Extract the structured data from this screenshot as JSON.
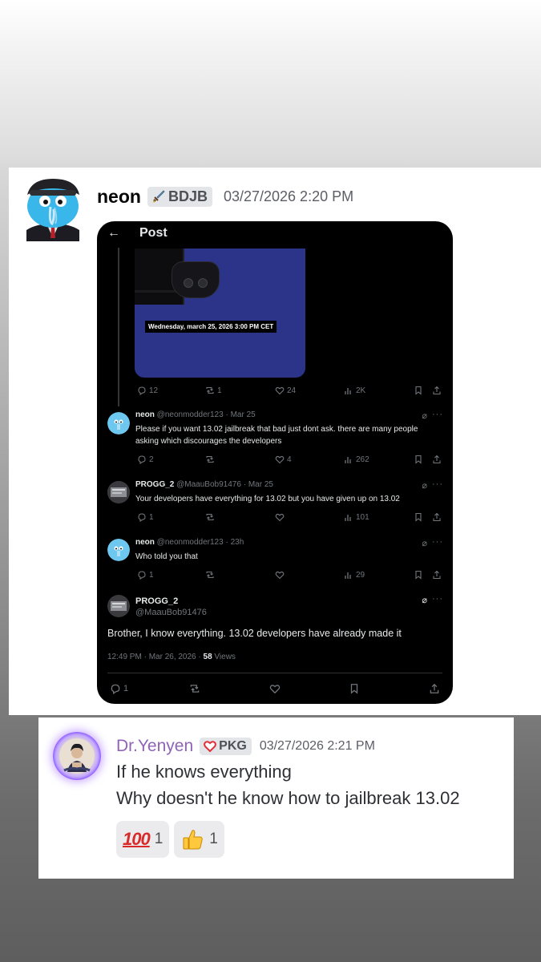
{
  "message1": {
    "username": "neon",
    "role_tag": "BDJB",
    "timestamp": "03/27/2026 2:20 PM",
    "screenshot": {
      "header_title": "Post",
      "media_date_banner": "Wednesday, march 25, 2026 3:00 PM CET",
      "parent_stats": {
        "replies": "12",
        "reposts": "1",
        "likes": "24",
        "views": "2K"
      },
      "replies": [
        {
          "name": "neon",
          "handle": "@neonmodder123",
          "time": "Mar 25",
          "text": "Please if you want 13.02 jailbreak that bad just dont ask. there are many people asking which discourages the developers",
          "stats": {
            "replies": "2",
            "reposts": "",
            "likes": "4",
            "views": "262"
          }
        },
        {
          "name": "PROGG_2",
          "handle": "@MaauBob91476",
          "time": "Mar 25",
          "text": "Your developers have everything for 13.02 but you have given up on 13.02",
          "stats": {
            "replies": "1",
            "reposts": "",
            "likes": "",
            "views": "101"
          }
        },
        {
          "name": "neon",
          "handle": "@neonmodder123",
          "time": "23h",
          "text": "Who told you that",
          "stats": {
            "replies": "1",
            "reposts": "",
            "likes": "",
            "views": "29"
          }
        }
      ],
      "main_tweet": {
        "name": "PROGG_2",
        "handle": "@MaauBob91476",
        "text": "Brother, I know everything. 13.02 developers have already made it",
        "time_meta": "12:49 PM · Mar 26, 2026 · ",
        "views_count": "58",
        "views_label": " Views",
        "stats": {
          "replies": "1"
        }
      }
    }
  },
  "message2": {
    "username": "Dr.Yenyen",
    "role_tag": "PKG",
    "timestamp": "03/27/2026 2:21 PM",
    "lines": [
      "If he knows everything",
      "Why doesn't he know how to jailbreak 13.02"
    ],
    "reactions": [
      {
        "emoji": "hundred-points",
        "glyph": "100",
        "count": "1"
      },
      {
        "emoji": "thumbs-up",
        "count": "1"
      }
    ]
  },
  "colors": {
    "x_background": "#000000",
    "x_text": "#e7e9ea",
    "x_muted": "#71767b",
    "username2_color": "#8f64b8",
    "media_blue": "#2b3488"
  }
}
